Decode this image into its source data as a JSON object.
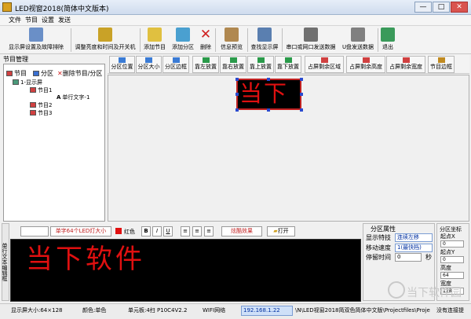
{
  "window": {
    "title": "LED视窗2018(简体中文版本)",
    "minimize": "—",
    "maximize": "□",
    "close": "✕"
  },
  "menu": [
    "文件",
    "节目",
    "设置",
    "发送"
  ],
  "toolbar": [
    {
      "label": "显示屏设置及故障排除",
      "icon": "display-settings-icon",
      "color": "#6a8fc7"
    },
    {
      "label": "调整亮度和时间及开关机",
      "icon": "brightness-time-icon",
      "color": "#c9a227"
    },
    {
      "label": "添加节目",
      "icon": "add-program-icon",
      "color": "#e0c040"
    },
    {
      "label": "添加分区",
      "icon": "add-partition-icon",
      "color": "#4aa0d0"
    },
    {
      "label": "删除",
      "icon": "delete-icon",
      "color": "#d02020"
    },
    {
      "label": "信息预览",
      "icon": "preview-icon",
      "color": "#b08850"
    },
    {
      "label": "查找显示屏",
      "icon": "find-display-icon",
      "color": "#5a7fb0"
    },
    {
      "label": "串口或网口发送数据",
      "icon": "send-serial-icon",
      "color": "#707070"
    },
    {
      "label": "U盘发送数据",
      "icon": "usb-send-icon",
      "color": "#808080"
    },
    {
      "label": "退出",
      "icon": "exit-icon",
      "color": "#3a9a5a"
    }
  ],
  "left_panel": {
    "header": "节目管理",
    "tree_toolbar": {
      "program": "节目",
      "partition": "分区",
      "delete": "删除节目/分区"
    },
    "tree": [
      "1-显示屏",
      "节目1",
      "单行文字-1",
      "节目2",
      "节目3"
    ]
  },
  "align_toolbar": [
    "分区位置",
    "分区大小",
    "分区边框",
    "靠左放置",
    "靠右放置",
    "靠上放置",
    "靠下放置",
    "占屏剩余区域",
    "占屏剩余高度",
    "占屏剩余宽度",
    "节目边框"
  ],
  "preview": {
    "text": "当下",
    "text_color": "#e01010",
    "border_color": "#c02020"
  },
  "editor": {
    "side_label": "单行文本编辑框",
    "font_select": "",
    "size_select": "单字64个LED灯大小",
    "color_label": "红色",
    "bold": "B",
    "italic": "I",
    "underline": "U",
    "align_left": "≡",
    "align_center": "≡",
    "align_right": "≡",
    "effect_label": "炫酷效果",
    "open_label": "打开",
    "content": "当下软件",
    "text_color": "#e01010"
  },
  "partition_props": {
    "title": "分区属性",
    "effect_label": "显示特技",
    "effect_value": "连续左移",
    "speed_label": "移动速度",
    "speed_value": "1(最快档)",
    "pause_label": "停留时间",
    "pause_value": "0",
    "pause_unit": "秒"
  },
  "coords": {
    "title": "分区坐标",
    "x_label": "起点X",
    "x_value": "0",
    "y_label": "起点Y",
    "y_value": "0",
    "h_label": "高度",
    "h_value": "64",
    "w_label": "宽度",
    "w_value": "128"
  },
  "statusbar": {
    "size": "显示屏大小:64×128",
    "color": "颜色:单色",
    "board": "单元板:4扫 P10C4V2.2",
    "wifi": "WIFI网络",
    "ip": "192.168.1.22",
    "path": "\\N\\LED视窗2018简双色简体中文版\\Projectfiles\\Proje",
    "save": "没有连接提"
  },
  "watermark": "当下软件园"
}
